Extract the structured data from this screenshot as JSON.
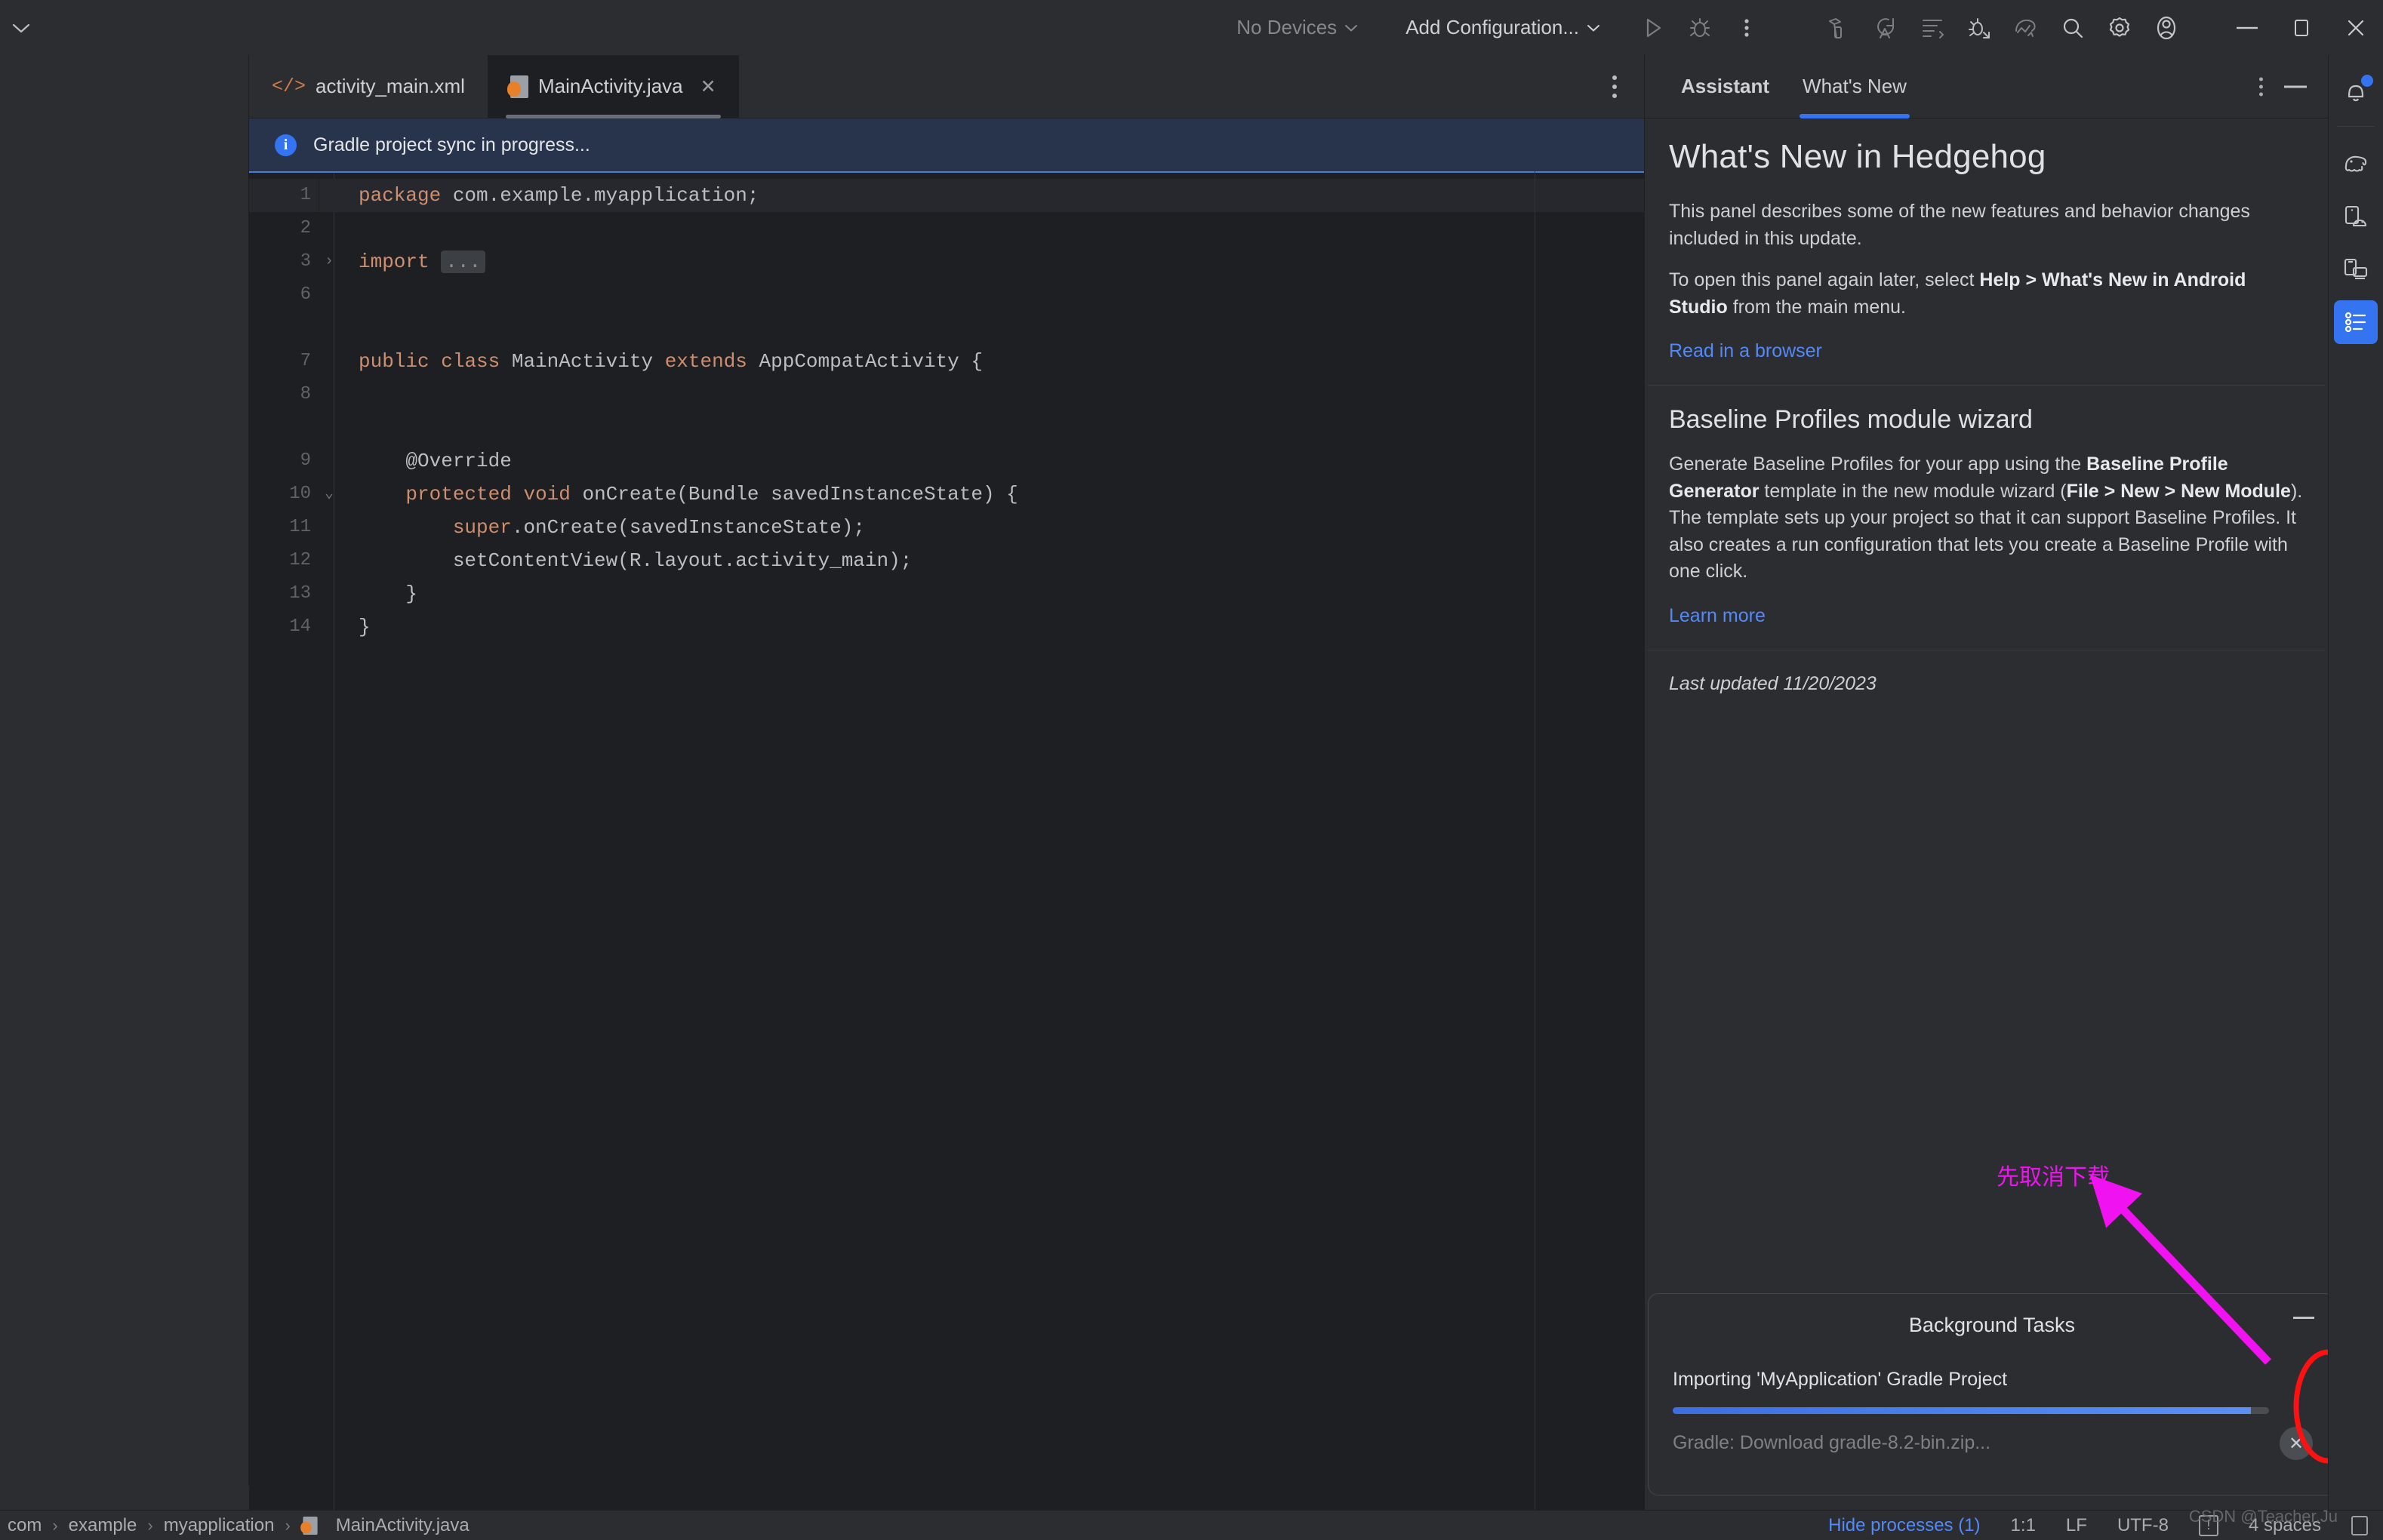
{
  "toolbar": {
    "device_selector": "No Devices",
    "run_config": "Add Configuration...",
    "icons": {
      "project_chevron": "chevron-down",
      "run": "run-play",
      "debug": "debug-bug",
      "more": "more-vertical",
      "build": "build-hammer",
      "sync": "sync-gradle",
      "code_format": "code-format",
      "attach_debugger": "attach-debugger",
      "profiler": "profiler",
      "search": "search",
      "settings": "settings-gear",
      "account": "user-account",
      "minimize": "window-minimize",
      "maximize": "window-maximize",
      "close": "window-close"
    }
  },
  "editor": {
    "tabs": [
      {
        "label": "activity_main.xml",
        "icon": "xml-file-icon",
        "active": false,
        "closable": false
      },
      {
        "label": "MainActivity.java",
        "icon": "java-file-icon",
        "active": true,
        "closable": true
      }
    ],
    "tab_close_glyph": "✕",
    "more_options": "more-vertical",
    "banner": {
      "text": "Gradle project sync in progress...",
      "icon": "info-icon",
      "bg_color": "#27344c",
      "accent_color": "#4e7ad6"
    },
    "lines": [
      {
        "num": "1",
        "highlight": true,
        "fold": "",
        "tokens": [
          {
            "t": "package",
            "c": "kw"
          },
          {
            "t": " com.example.myapplication;",
            "c": "plain"
          }
        ]
      },
      {
        "num": "2",
        "highlight": false,
        "fold": "",
        "tokens": []
      },
      {
        "num": "3",
        "highlight": false,
        "fold": "›",
        "tokens": [
          {
            "t": "import",
            "c": "kw"
          },
          {
            "t": " ",
            "c": "plain"
          },
          {
            "t": "...",
            "c": "folded"
          }
        ]
      },
      {
        "num": "6",
        "highlight": false,
        "fold": "",
        "tokens": []
      },
      {
        "num": "",
        "highlight": false,
        "fold": "",
        "tokens": []
      },
      {
        "num": "7",
        "highlight": false,
        "fold": "",
        "tokens": [
          {
            "t": "public",
            "c": "kw"
          },
          {
            "t": " ",
            "c": "plain"
          },
          {
            "t": "class",
            "c": "kw"
          },
          {
            "t": " MainActivity ",
            "c": "plain"
          },
          {
            "t": "extends",
            "c": "kw"
          },
          {
            "t": " AppCompatActivity {",
            "c": "plain"
          }
        ]
      },
      {
        "num": "8",
        "highlight": false,
        "fold": "",
        "tokens": []
      },
      {
        "num": "",
        "highlight": false,
        "fold": "",
        "tokens": []
      },
      {
        "num": "9",
        "highlight": false,
        "fold": "",
        "tokens": [
          {
            "t": "    @Override",
            "c": "ann"
          }
        ]
      },
      {
        "num": "10",
        "highlight": false,
        "fold": "⌄",
        "tokens": [
          {
            "t": "    ",
            "c": "plain"
          },
          {
            "t": "protected",
            "c": "kw"
          },
          {
            "t": " ",
            "c": "plain"
          },
          {
            "t": "void",
            "c": "kw"
          },
          {
            "t": " onCreate(Bundle savedInstanceState) {",
            "c": "plain"
          }
        ]
      },
      {
        "num": "11",
        "highlight": false,
        "fold": "",
        "tokens": [
          {
            "t": "        ",
            "c": "plain"
          },
          {
            "t": "super",
            "c": "kw"
          },
          {
            "t": ".onCreate(savedInstanceState);",
            "c": "plain"
          }
        ]
      },
      {
        "num": "12",
        "highlight": false,
        "fold": "",
        "tokens": [
          {
            "t": "        setContentView(R.layout.activity_main);",
            "c": "plain"
          }
        ]
      },
      {
        "num": "13",
        "highlight": false,
        "fold": "",
        "tokens": [
          {
            "t": "    }",
            "c": "plain"
          }
        ]
      },
      {
        "num": "14",
        "highlight": false,
        "fold": "",
        "tokens": [
          {
            "t": "}",
            "c": "plain"
          }
        ]
      }
    ]
  },
  "assistant": {
    "tabs": [
      {
        "label": "Assistant",
        "selected": false,
        "bold": true
      },
      {
        "label": "What's New",
        "selected": true,
        "bold": false
      }
    ],
    "actions": {
      "more": "more-vertical",
      "minimize": "minimize-icon"
    },
    "heading": "What's New in Hedgehog",
    "intro": "This panel describes some of the new features and behavior changes included in this update.",
    "reopen_prefix": "To open this panel again later, select ",
    "reopen_bold": "Help > What's New in Android Studio",
    "reopen_suffix": " from the main menu.",
    "read_in_browser": "Read in a browser",
    "section_title": "Baseline Profiles module wizard",
    "section_p1": "Generate Baseline Profiles for your app using the ",
    "section_b1": "Baseline Profile Generator",
    "section_p2": " template in the new module wizard (",
    "section_b2": "File > New > New Module",
    "section_p3": "). The template sets up your project so that it can support Baseline Profiles. It also creates a run configuration that lets you create a Baseline Profile with one click.",
    "learn_more": "Learn more",
    "last_updated": "Last updated 11/20/2023"
  },
  "background_tasks": {
    "title": "Background Tasks",
    "task_name": "Importing 'MyApplication' Gradle Project",
    "sub_text": "Gradle: Download gradle-8.2-bin.zip...",
    "progress_percent": 97,
    "cancel_glyph": "✕",
    "minimize": "minimize-icon",
    "progress_color": "#4d85ee"
  },
  "annotation": {
    "text": "先取消下载",
    "color": "#f012f0",
    "highlight_color": "#ff1111"
  },
  "right_stripe": {
    "items": [
      {
        "name": "notifications-icon",
        "label": "Notifications",
        "active": false,
        "badge": true
      },
      {
        "name": "gradle-elephant-icon",
        "label": "Gradle",
        "active": false,
        "badge": false
      },
      {
        "name": "device-manager-icon",
        "label": "Device Manager",
        "active": false,
        "badge": false
      },
      {
        "name": "running-devices-icon",
        "label": "Running Devices",
        "active": false,
        "badge": false
      },
      {
        "name": "assistant-icon",
        "label": "Assistant",
        "active": true,
        "badge": false
      }
    ]
  },
  "statusbar": {
    "breadcrumbs": [
      "com",
      "example",
      "myapplication",
      "MainActivity.java"
    ],
    "separator": "›",
    "hide_processes": "Hide processes (1)",
    "caret_position": "1:1",
    "line_separator": "LF",
    "encoding": "UTF-8",
    "indent": "4 spaces",
    "warning_icon": "warning-icon",
    "lock_icon": "lock-icon",
    "watermark": "CSDN @Teacher.Ju"
  }
}
